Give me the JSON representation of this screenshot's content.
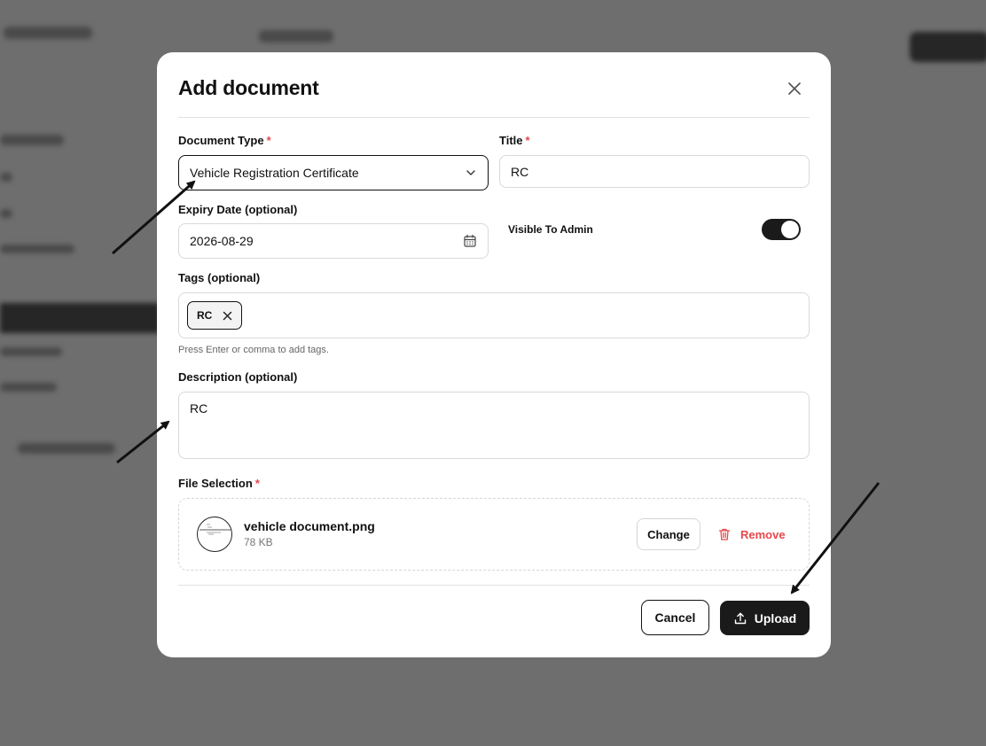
{
  "dialog": {
    "title": "Add document"
  },
  "document_type": {
    "label": "Document Type",
    "required_mark": "*",
    "value": "Vehicle Registration Certificate"
  },
  "title_field": {
    "label": "Title",
    "required_mark": "*",
    "value": "RC"
  },
  "expiry": {
    "label": "Expiry Date (optional)",
    "value": "2026-08-29"
  },
  "visible_to_admin": {
    "label": "Visible To Admin",
    "on": true
  },
  "tags": {
    "label": "Tags (optional)",
    "items": [
      "RC"
    ],
    "hint": "Press Enter or comma to add tags."
  },
  "description": {
    "label": "Description (optional)",
    "value": "RC"
  },
  "file_selection": {
    "label": "File Selection",
    "required_mark": "*",
    "file_name": "vehicle document.png",
    "file_size": "78 KB",
    "change_label": "Change",
    "remove_label": "Remove"
  },
  "footer": {
    "cancel_label": "Cancel",
    "upload_label": "Upload"
  },
  "colors": {
    "accent_dark": "#1a1a1a",
    "required_red": "#e5484d",
    "overlay": "#6e6e6e"
  },
  "icons": {
    "close": "close-icon",
    "dropdown": "chevron-down-icon",
    "calendar": "calendar-icon",
    "tag_remove": "close-icon",
    "trash": "trash-icon",
    "upload": "upload-icon"
  }
}
